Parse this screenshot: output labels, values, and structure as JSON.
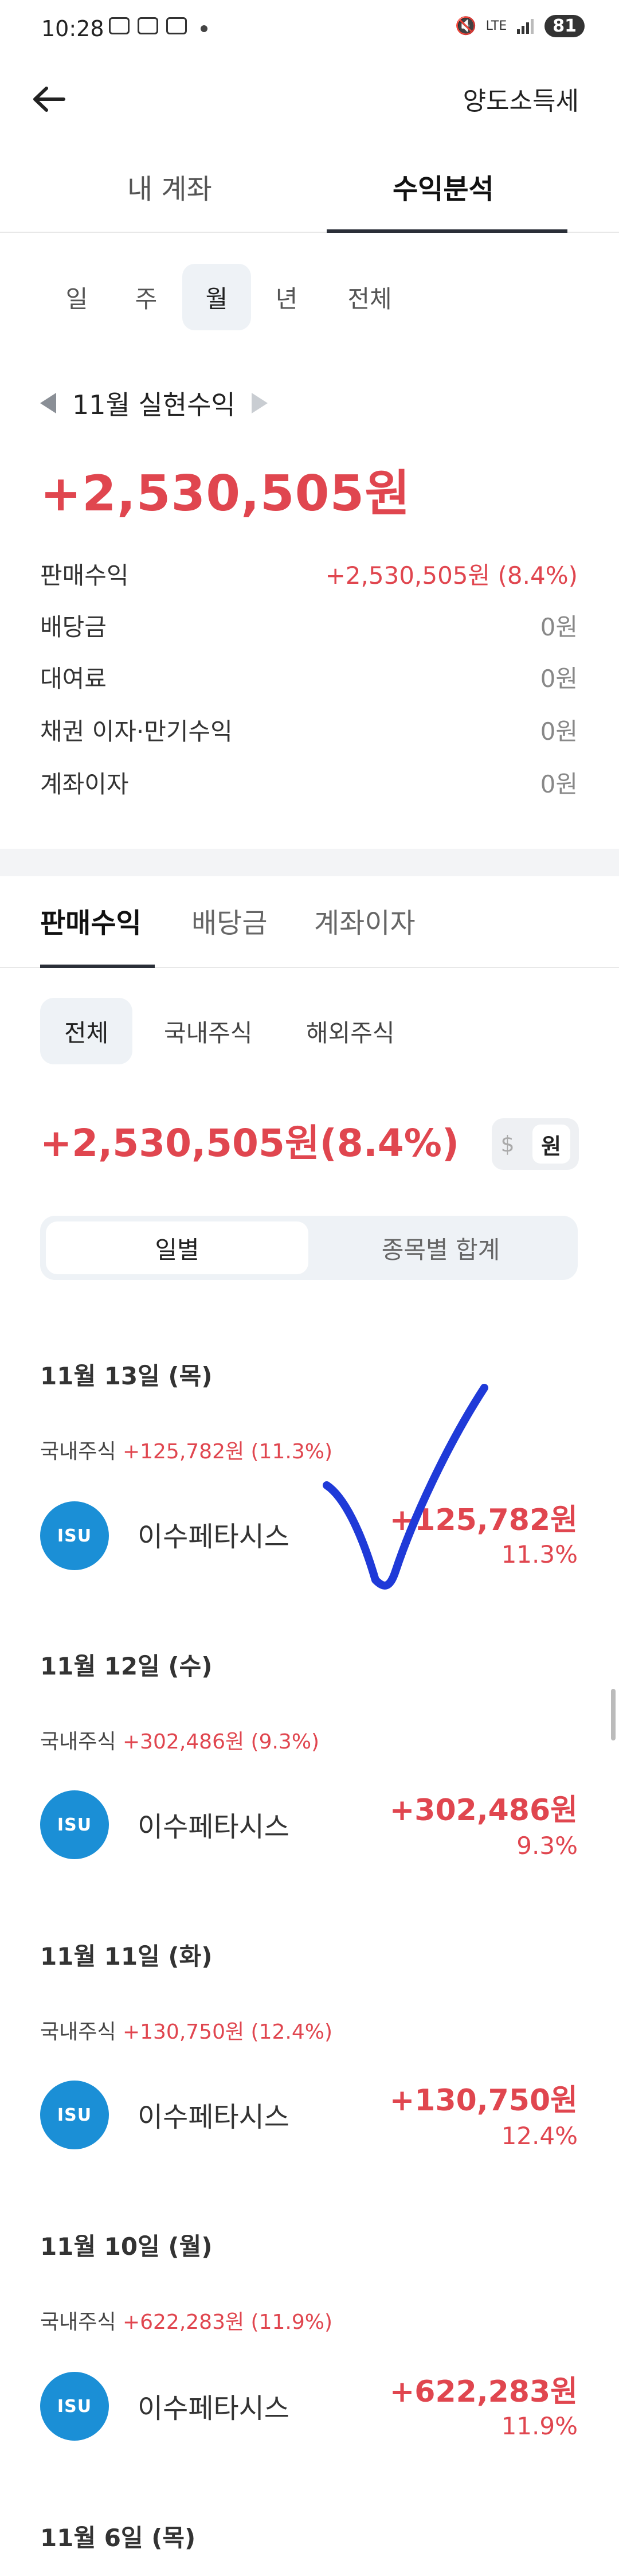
{
  "status": {
    "time": "10:28",
    "battery": "81",
    "network": "LTE"
  },
  "header": {
    "title": "양도소득세"
  },
  "top_tabs": [
    "내 계좌",
    "수익분석"
  ],
  "periods": [
    "일",
    "주",
    "월",
    "년",
    "전체"
  ],
  "realized": {
    "month_label": "11월 실현수익",
    "amount": "+2,530,505원",
    "rows": [
      {
        "label": "판매수익",
        "value": "+2,530,505원 (8.4%)"
      },
      {
        "label": "배당금",
        "value": "0원"
      },
      {
        "label": "대여료",
        "value": "0원"
      },
      {
        "label": "채권 이자·만기수익",
        "value": "0원"
      },
      {
        "label": "계좌이자",
        "value": "0원"
      }
    ]
  },
  "sub_tabs": [
    "판매수익",
    "배당금",
    "계좌이자"
  ],
  "markets": [
    "전체",
    "국내주식",
    "해외주식"
  ],
  "total": {
    "amount": "+2,530,505원(8.4%)",
    "currency_usd": "$",
    "currency_krw": "원"
  },
  "segments": [
    "일별",
    "종목별 합계"
  ],
  "days": [
    {
      "date": "11월 13일 (목)",
      "market": "국내주식",
      "market_summary": "+125,782원 (11.3%)",
      "stock": "이수페타시스",
      "logo": "ISU",
      "amount": "+125,782원",
      "pct": "11.3%"
    },
    {
      "date": "11월 12일 (수)",
      "market": "국내주식",
      "market_summary": "+302,486원 (9.3%)",
      "stock": "이수페타시스",
      "logo": "ISU",
      "amount": "+302,486원",
      "pct": "9.3%"
    },
    {
      "date": "11월 11일 (화)",
      "market": "국내주식",
      "market_summary": "+130,750원 (12.4%)",
      "stock": "이수페타시스",
      "logo": "ISU",
      "amount": "+130,750원",
      "pct": "12.4%"
    },
    {
      "date": "11월 10일 (월)",
      "market": "국내주식",
      "market_summary": "+622,283원 (11.9%)",
      "stock": "이수페타시스",
      "logo": "ISU",
      "amount": "+622,283원",
      "pct": "11.9%"
    },
    {
      "date": "11월 6일 (목)"
    }
  ],
  "colors": {
    "profit_red": "#e0464f",
    "logo_blue": "#1b8fd6",
    "check_blue": "#1f3ad8"
  }
}
